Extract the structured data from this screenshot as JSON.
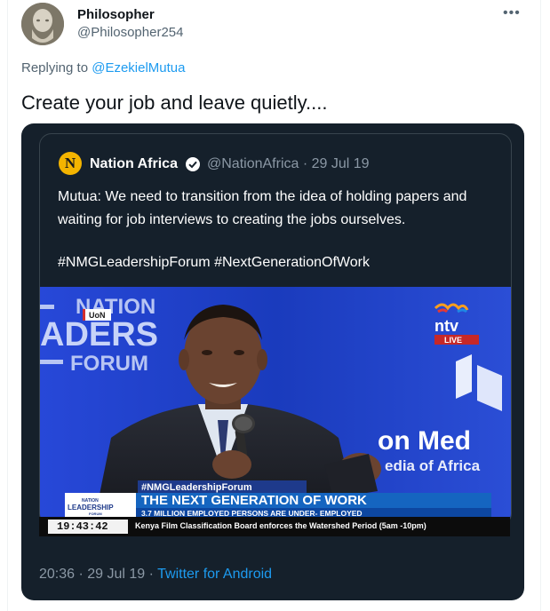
{
  "tweet": {
    "display_name": "Philosopher",
    "handle": "@Philosopher254",
    "more_icon": "•••",
    "replying_prefix": "Replying to ",
    "replying_to": "@EzekielMutua",
    "text": "Create your job and leave quietly...."
  },
  "screenshot": {
    "quote": {
      "logo_letter": "N",
      "name": "Nation Africa",
      "meta": "@NationAfrica · 29 Jul 19",
      "text": "Mutua: We need to transition from the idea of holding papers and waiting for job interviews to creating the jobs ourselves.",
      "hashtags": "#NMGLeadershipForum #NextGenerationOfWork"
    },
    "broadcast": {
      "backdrop_line1": "NATION",
      "backdrop_line2": "ADERS",
      "backdrop_line3": "FORUM",
      "backdrop_right1": "on Med",
      "backdrop_right2": "edia of Africa",
      "uon_tag": "UoN",
      "channel_logo": "ntv",
      "live": "LIVE",
      "tag_label": "#NMGLeadershipForum",
      "forum_badge_top": "NATION",
      "forum_badge_mid": "LEADERSHIP",
      "forum_badge_bot": "FORUM",
      "headline": "THE NEXT GENERATION OF WORK",
      "subheadline": "3.7 MILLION EMPLOYED PERSONS ARE UNDER- EMPLOYED",
      "clock": "19:43:42",
      "ticker": "Kenya Film Classification Board enforces the Watershed Period (5am -10pm)"
    },
    "footer_time": "20:36 · 29 Jul 19 · ",
    "footer_source": "Twitter for Android"
  },
  "colors": {
    "link": "#1d9bf0",
    "dark_bg": "#15202b",
    "stage_blue": "#1d3fc4"
  }
}
